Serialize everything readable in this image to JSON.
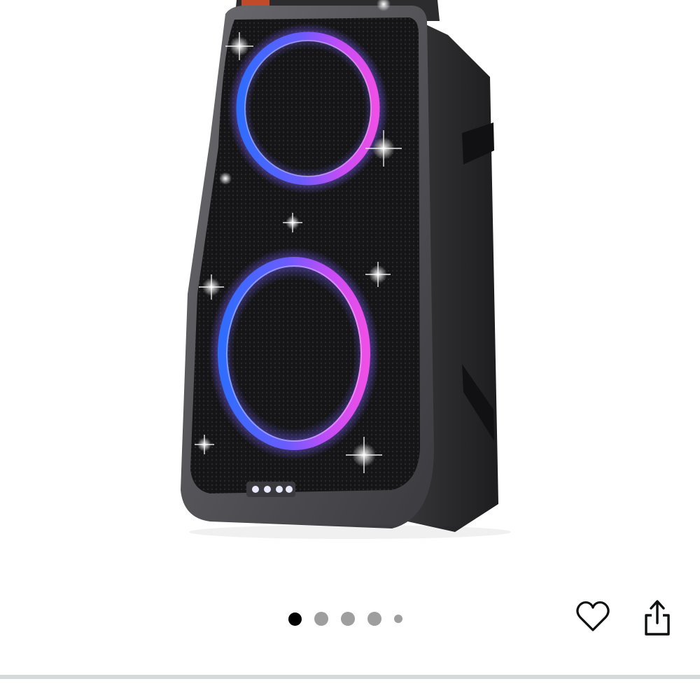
{
  "product": {
    "image_alt": "Portable party speaker with blue and pink LED ring lights"
  },
  "gallery": {
    "image_count": 5,
    "active_index": 0,
    "dot_color": "#9e9e9e",
    "active_dot_color": "#000000"
  },
  "actions": {
    "wishlist_icon": "heart-outline-icon",
    "share_icon": "share-icon"
  },
  "colors": {
    "ring_blue": "#3f8cff",
    "ring_pink": "#e24cf0",
    "speaker_body": "#2b2b2d",
    "divider": "#d5d9d9"
  }
}
